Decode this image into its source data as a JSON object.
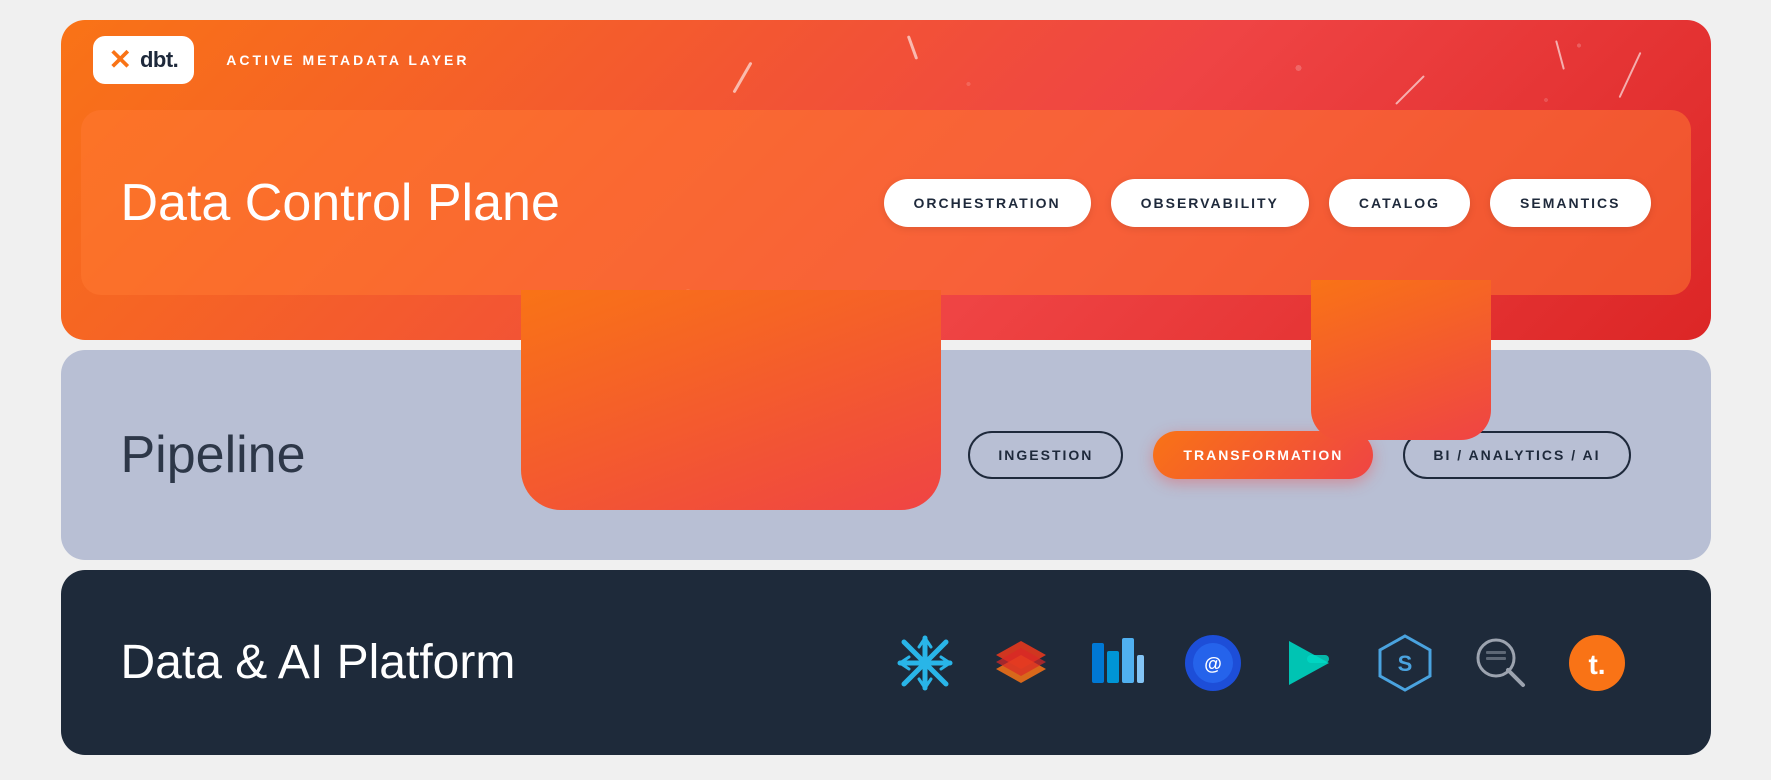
{
  "header": {
    "logo_symbol": "✕",
    "logo_text": "dbt.",
    "metadata_label": "ACTIVE METADATA LAYER"
  },
  "data_control_plane": {
    "title": "Data Control Plane",
    "pills": [
      {
        "id": "orchestration",
        "label": "ORCHESTRATION"
      },
      {
        "id": "observability",
        "label": "OBSERVABILITY"
      },
      {
        "id": "catalog",
        "label": "CATALOG"
      },
      {
        "id": "semantics",
        "label": "SEMANTICS"
      }
    ]
  },
  "pipeline": {
    "title": "Pipeline",
    "pills": [
      {
        "id": "ingestion",
        "label": "INGESTION"
      },
      {
        "id": "transformation",
        "label": "TRANSFORMATION"
      },
      {
        "id": "bi-analytics-ai",
        "label": "BI / ANALYTICS / AI"
      }
    ]
  },
  "data_ai_platform": {
    "title": "Data & AI Platform",
    "icons": [
      {
        "id": "snowflake",
        "label": "Snowflake",
        "color": "#29b5e8"
      },
      {
        "id": "databricks",
        "label": "Databricks",
        "color": "#e3371e"
      },
      {
        "id": "azure-synapse",
        "label": "Azure Synapse",
        "color": "#0078d4"
      },
      {
        "id": "atlan",
        "label": "Atlan",
        "color": "#3b6fff"
      },
      {
        "id": "fivetran",
        "label": "Fivetran",
        "color": "#00c4b3"
      },
      {
        "id": "starburst",
        "label": "Starburst",
        "color": "#4aa3df"
      },
      {
        "id": "search-tool",
        "label": "Search Tool",
        "color": "#6b7280"
      },
      {
        "id": "talend",
        "label": "Talend",
        "color": "#f97316"
      }
    ]
  },
  "colors": {
    "orange_primary": "#f97316",
    "orange_dark": "#ef4444",
    "pipeline_bg": "#b8bfd4",
    "platform_bg": "#1e2a3a",
    "white": "#ffffff",
    "dark_text": "#1e293b"
  }
}
